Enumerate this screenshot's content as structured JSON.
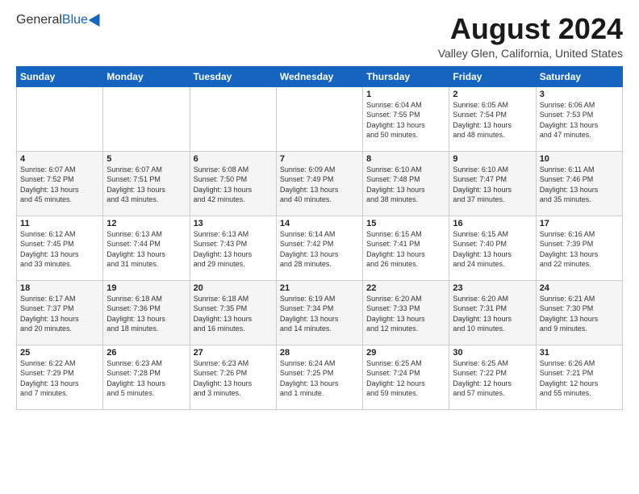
{
  "header": {
    "logo_general": "General",
    "logo_blue": "Blue",
    "month_title": "August 2024",
    "location": "Valley Glen, California, United States"
  },
  "days_of_week": [
    "Sunday",
    "Monday",
    "Tuesday",
    "Wednesday",
    "Thursday",
    "Friday",
    "Saturday"
  ],
  "weeks": [
    [
      {
        "day": "",
        "info": ""
      },
      {
        "day": "",
        "info": ""
      },
      {
        "day": "",
        "info": ""
      },
      {
        "day": "",
        "info": ""
      },
      {
        "day": "1",
        "info": "Sunrise: 6:04 AM\nSunset: 7:55 PM\nDaylight: 13 hours\nand 50 minutes."
      },
      {
        "day": "2",
        "info": "Sunrise: 6:05 AM\nSunset: 7:54 PM\nDaylight: 13 hours\nand 48 minutes."
      },
      {
        "day": "3",
        "info": "Sunrise: 6:06 AM\nSunset: 7:53 PM\nDaylight: 13 hours\nand 47 minutes."
      }
    ],
    [
      {
        "day": "4",
        "info": "Sunrise: 6:07 AM\nSunset: 7:52 PM\nDaylight: 13 hours\nand 45 minutes."
      },
      {
        "day": "5",
        "info": "Sunrise: 6:07 AM\nSunset: 7:51 PM\nDaylight: 13 hours\nand 43 minutes."
      },
      {
        "day": "6",
        "info": "Sunrise: 6:08 AM\nSunset: 7:50 PM\nDaylight: 13 hours\nand 42 minutes."
      },
      {
        "day": "7",
        "info": "Sunrise: 6:09 AM\nSunset: 7:49 PM\nDaylight: 13 hours\nand 40 minutes."
      },
      {
        "day": "8",
        "info": "Sunrise: 6:10 AM\nSunset: 7:48 PM\nDaylight: 13 hours\nand 38 minutes."
      },
      {
        "day": "9",
        "info": "Sunrise: 6:10 AM\nSunset: 7:47 PM\nDaylight: 13 hours\nand 37 minutes."
      },
      {
        "day": "10",
        "info": "Sunrise: 6:11 AM\nSunset: 7:46 PM\nDaylight: 13 hours\nand 35 minutes."
      }
    ],
    [
      {
        "day": "11",
        "info": "Sunrise: 6:12 AM\nSunset: 7:45 PM\nDaylight: 13 hours\nand 33 minutes."
      },
      {
        "day": "12",
        "info": "Sunrise: 6:13 AM\nSunset: 7:44 PM\nDaylight: 13 hours\nand 31 minutes."
      },
      {
        "day": "13",
        "info": "Sunrise: 6:13 AM\nSunset: 7:43 PM\nDaylight: 13 hours\nand 29 minutes."
      },
      {
        "day": "14",
        "info": "Sunrise: 6:14 AM\nSunset: 7:42 PM\nDaylight: 13 hours\nand 28 minutes."
      },
      {
        "day": "15",
        "info": "Sunrise: 6:15 AM\nSunset: 7:41 PM\nDaylight: 13 hours\nand 26 minutes."
      },
      {
        "day": "16",
        "info": "Sunrise: 6:15 AM\nSunset: 7:40 PM\nDaylight: 13 hours\nand 24 minutes."
      },
      {
        "day": "17",
        "info": "Sunrise: 6:16 AM\nSunset: 7:39 PM\nDaylight: 13 hours\nand 22 minutes."
      }
    ],
    [
      {
        "day": "18",
        "info": "Sunrise: 6:17 AM\nSunset: 7:37 PM\nDaylight: 13 hours\nand 20 minutes."
      },
      {
        "day": "19",
        "info": "Sunrise: 6:18 AM\nSunset: 7:36 PM\nDaylight: 13 hours\nand 18 minutes."
      },
      {
        "day": "20",
        "info": "Sunrise: 6:18 AM\nSunset: 7:35 PM\nDaylight: 13 hours\nand 16 minutes."
      },
      {
        "day": "21",
        "info": "Sunrise: 6:19 AM\nSunset: 7:34 PM\nDaylight: 13 hours\nand 14 minutes."
      },
      {
        "day": "22",
        "info": "Sunrise: 6:20 AM\nSunset: 7:33 PM\nDaylight: 13 hours\nand 12 minutes."
      },
      {
        "day": "23",
        "info": "Sunrise: 6:20 AM\nSunset: 7:31 PM\nDaylight: 13 hours\nand 10 minutes."
      },
      {
        "day": "24",
        "info": "Sunrise: 6:21 AM\nSunset: 7:30 PM\nDaylight: 13 hours\nand 9 minutes."
      }
    ],
    [
      {
        "day": "25",
        "info": "Sunrise: 6:22 AM\nSunset: 7:29 PM\nDaylight: 13 hours\nand 7 minutes."
      },
      {
        "day": "26",
        "info": "Sunrise: 6:23 AM\nSunset: 7:28 PM\nDaylight: 13 hours\nand 5 minutes."
      },
      {
        "day": "27",
        "info": "Sunrise: 6:23 AM\nSunset: 7:26 PM\nDaylight: 13 hours\nand 3 minutes."
      },
      {
        "day": "28",
        "info": "Sunrise: 6:24 AM\nSunset: 7:25 PM\nDaylight: 13 hours\nand 1 minute."
      },
      {
        "day": "29",
        "info": "Sunrise: 6:25 AM\nSunset: 7:24 PM\nDaylight: 12 hours\nand 59 minutes."
      },
      {
        "day": "30",
        "info": "Sunrise: 6:25 AM\nSunset: 7:22 PM\nDaylight: 12 hours\nand 57 minutes."
      },
      {
        "day": "31",
        "info": "Sunrise: 6:26 AM\nSunset: 7:21 PM\nDaylight: 12 hours\nand 55 minutes."
      }
    ]
  ]
}
